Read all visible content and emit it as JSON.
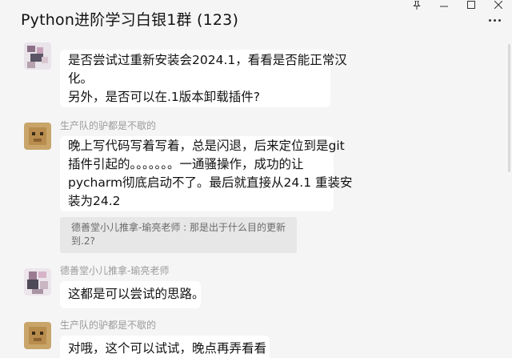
{
  "window": {
    "title": "Python进阶学习白银1群 (123)",
    "controls": [
      {
        "name": "pin-icon"
      },
      {
        "name": "minimize-icon"
      },
      {
        "name": "maximize-icon"
      },
      {
        "name": "close-icon"
      }
    ],
    "more_icon": "more-dots-icon"
  },
  "messages": [
    {
      "sender": "",
      "lines": [
        "是否尝试过重新安装会2024.1，看看是否能正常汉",
        "化。",
        "另外，是否可以在.1版本卸载插件?"
      ]
    },
    {
      "sender": "生产队的驴都是不歇的",
      "lines": [
        "晚上写代码写着写着，总是闪退，后来定位到是git",
        "插件引起的。。。。。。。一通骚操作，成功的让",
        "pycharm彻底启动不了。最后就直接从24.1 重装安",
        "装为24.2"
      ],
      "quote_lines": [
        "德善堂小儿推拿-瑜亮老师 : 那是出于什么目的更新",
        "到.2?"
      ]
    },
    {
      "sender": "德善堂小儿推拿-瑜亮老师",
      "lines": [
        "这都是可以尝试的思路。"
      ]
    },
    {
      "sender": "生产队的驴都是不歇的",
      "lines": [
        "对哦，这个可以试试，晚点再弄看看"
      ]
    }
  ],
  "colors": {
    "background": "#f5f5f5",
    "bubble": "#ffffff",
    "quote_bg": "#e7e7e7",
    "sender_text": "#9b9b9b"
  }
}
